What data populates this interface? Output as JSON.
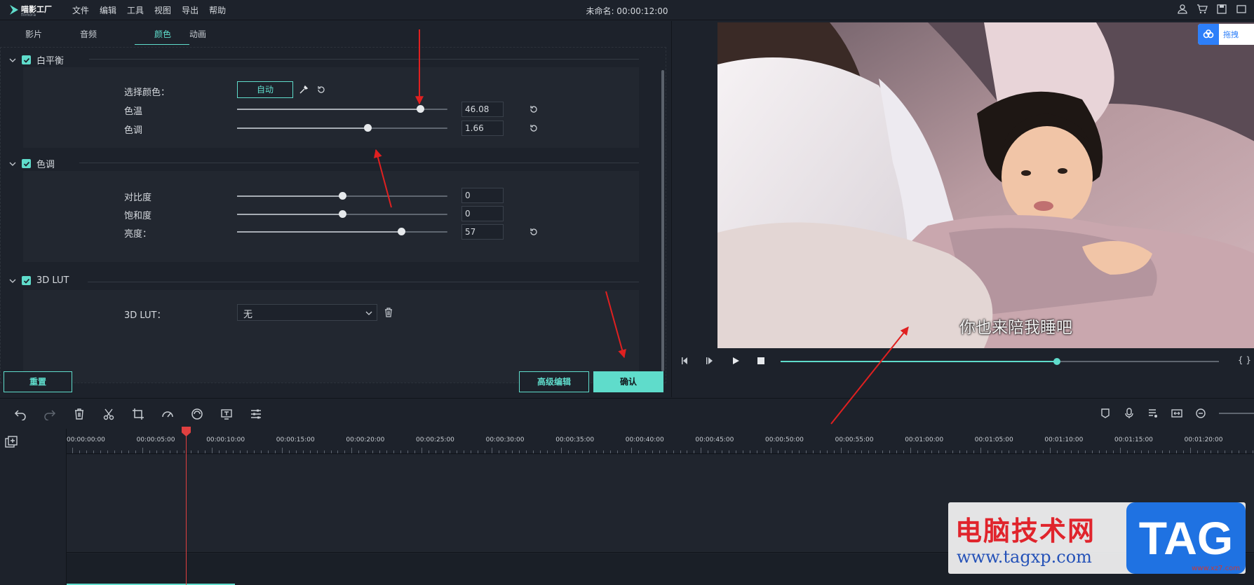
{
  "app": {
    "logo_name": "喵影工厂",
    "logo_sub": "filmora"
  },
  "menu": [
    "文件",
    "编辑",
    "工具",
    "视图",
    "导出",
    "帮助"
  ],
  "project_title": "未命名: 00:00:12:00",
  "tabs": [
    {
      "label": "影片"
    },
    {
      "label": "音频"
    },
    {
      "label": "颜色"
    },
    {
      "label": "动画"
    }
  ],
  "white_balance": {
    "title": "白平衡",
    "select_color_label": "选择颜色：",
    "auto_label": "自动",
    "temp": {
      "label": "色温",
      "value": "46.08",
      "level": 0.87
    },
    "tint": {
      "label": "色调",
      "value": "1.66",
      "level": 0.62
    }
  },
  "tone": {
    "title": "色调",
    "contrast": {
      "label": "对比度",
      "value": "0",
      "level": 0.5
    },
    "saturation": {
      "label": "饱和度",
      "value": "0",
      "level": 0.5
    },
    "brightness": {
      "label": "亮度：",
      "value": "57",
      "level": 0.78
    }
  },
  "lut": {
    "title": "3D LUT",
    "label": "3D LUT：",
    "selected": "无"
  },
  "buttons": {
    "reset": "重置",
    "advanced": "高级编辑",
    "confirm": "确认"
  },
  "preview": {
    "subtitle": "你也来陪我睡吧",
    "cloud_label": "拖拽",
    "progress": 0.63,
    "brace": "{ }"
  },
  "timeline": {
    "ticks": [
      "00:00:00:00",
      "00:00:05:00",
      "00:00:10:00",
      "00:00:15:00",
      "00:00:20:00",
      "00:00:25:00",
      "00:00:30:00",
      "00:00:35:00",
      "00:00:40:00",
      "00:00:45:00",
      "00:00:50:00",
      "00:00:55:00",
      "00:01:00:00",
      "00:01:05:00",
      "00:01:10:00",
      "00:01:15:00",
      "00:01:20:00"
    ]
  },
  "watermark": {
    "title": "电脑技术网",
    "url": "www.tagxp.com",
    "tag": "TAG",
    "small": "www.xz7.com"
  },
  "colors": {
    "accent": "#5fdccb",
    "bg": "#1d222b",
    "arrow": "#e02020"
  }
}
